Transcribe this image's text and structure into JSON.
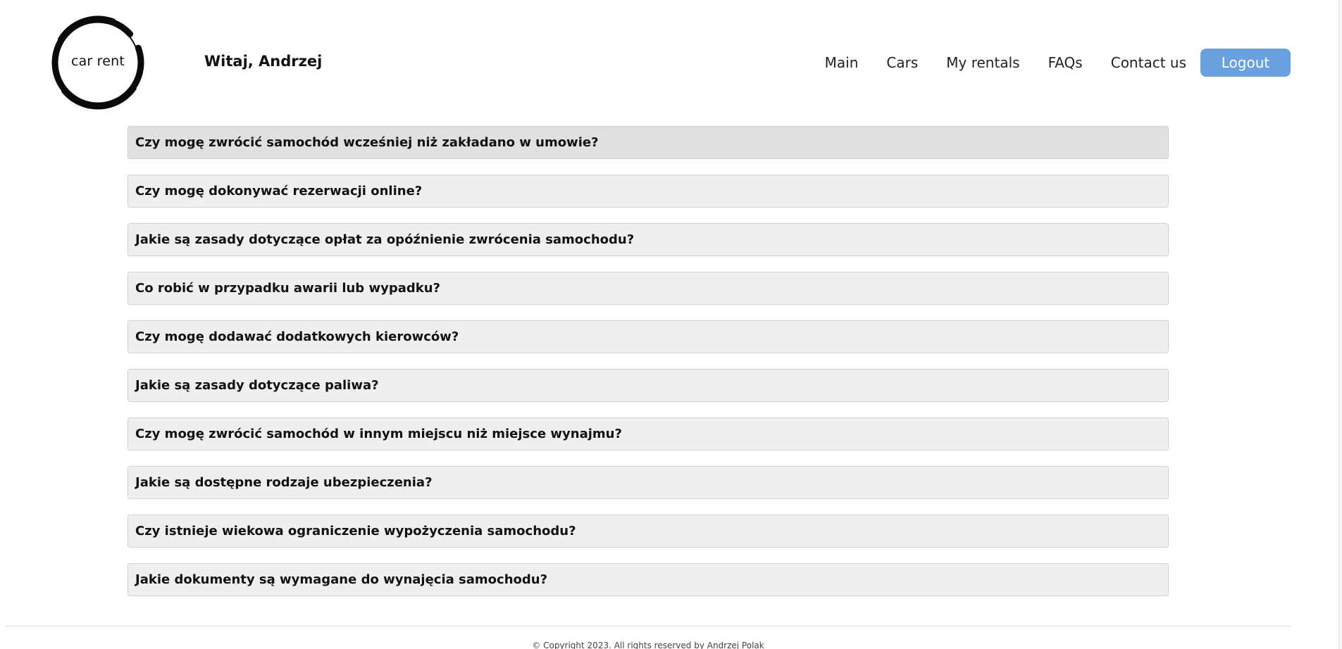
{
  "header": {
    "logo_text": "car rent",
    "greeting": "Witaj, Andrzej"
  },
  "nav": {
    "items": [
      "Main",
      "Cars",
      "My rentals",
      "FAQs",
      "Contact us"
    ],
    "logout_label": "Logout"
  },
  "faq": {
    "questions": [
      "Czy mogę zwrócić samochód wcześniej niż zakładano w umowie?",
      "Czy mogę dokonywać rezerwacji online?",
      "Jakie są zasady dotyczące opłat za opóźnienie zwrócenia samochodu?",
      "Co robić w przypadku awarii lub wypadku?",
      "Czy mogę dodawać dodatkowych kierowców?",
      "Jakie są zasady dotyczące paliwa?",
      "Czy mogę zwrócić samochód w innym miejscu niż miejsce wynajmu?",
      "Jakie są dostępne rodzaje ubezpieczenia?",
      "Czy istnieje wiekowa ograniczenie wypożyczenia samochodu?",
      "Jakie dokumenty są wymagane do wynajęcia samochodu?"
    ]
  },
  "footer": {
    "copyright": "© Copyright 2023. All rights reserved by Andrzej Polak"
  },
  "colors": {
    "accent": "#6a9fe0",
    "faq_background": "#efefef",
    "faq_active_background": "#e0e0e0"
  }
}
